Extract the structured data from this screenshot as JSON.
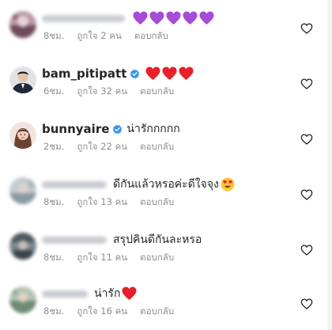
{
  "comments": [
    {
      "username": "",
      "username_blurred": true,
      "verified": false,
      "text": "",
      "emoji": [
        "purple-heart",
        "purple-heart",
        "purple-heart",
        "purple-heart",
        "purple-heart"
      ],
      "time": "8ชม.",
      "likes": "ถูกใจ 2 คน",
      "reply": "ตอบกลับ"
    },
    {
      "username": "bam_pitipatt",
      "username_blurred": false,
      "verified": true,
      "text": "",
      "emoji": [
        "red-heart",
        "red-heart",
        "red-heart"
      ],
      "time": "6ชม.",
      "likes": "ถูกใจ 32 คน",
      "reply": "ตอบกลับ"
    },
    {
      "username": "bunnyaire",
      "username_blurred": false,
      "verified": true,
      "text": "น่ารักกกกก",
      "emoji": [],
      "time": "2ชม.",
      "likes": "ถูกใจ 22 คน",
      "reply": "ตอบกลับ"
    },
    {
      "username": "",
      "username_blurred": true,
      "verified": false,
      "text": "ดีกันแล้วหรอค่ะดีใจจุง",
      "emoji": [
        "heart-eyes-face"
      ],
      "time": "8ชม.",
      "likes": "ถูกใจ 13 คน",
      "reply": "ตอบกลับ"
    },
    {
      "username": "",
      "username_blurred": true,
      "verified": false,
      "text": "สรุปคินดีกันละหรอ",
      "emoji": [],
      "time": "8ชม.",
      "likes": "ถูกใจ 11 คน",
      "reply": "ตอบกลับ"
    },
    {
      "username": "",
      "username_blurred": true,
      "verified": false,
      "text": "น่ารัก",
      "emoji": [
        "red-heart"
      ],
      "time": "8ชม.",
      "likes": "ถูกใจ 16 คน",
      "reply": "ตอบกลับ"
    }
  ],
  "colors": {
    "text": "#262626",
    "meta": "#8e8e8e",
    "verified": "#3897f0",
    "red_heart": "#e8202c",
    "purple_heart": "#a64dd8"
  },
  "icons": {
    "like": "heart-outline-icon",
    "verified": "verified-badge-icon"
  }
}
